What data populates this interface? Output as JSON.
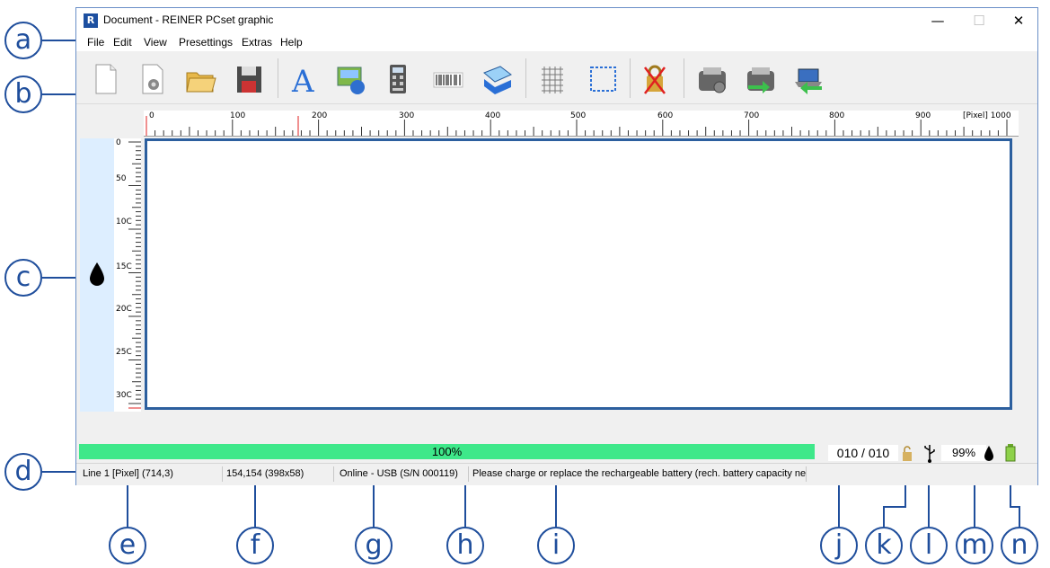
{
  "window": {
    "title": "Document - REINER PCset graphic",
    "app_icon_letter": "R",
    "minimize": "—",
    "maximize": "☐",
    "close": "✕"
  },
  "menu": [
    "File",
    "Edit",
    "View",
    "Presettings",
    "Extras",
    "Help"
  ],
  "toolbar": {
    "icons": [
      "new-document-icon",
      "new-from-template-icon",
      "open-folder-icon",
      "save-disk-icon",
      "text-icon",
      "image-icon",
      "calculator-icon",
      "barcode-icon",
      "layers-icon",
      "grid-icon",
      "selection-frame-icon",
      "lock-crossed-icon",
      "printer-settings-icon",
      "send-to-printer-icon",
      "receive-from-printer-icon"
    ]
  },
  "ruler": {
    "horizontal_labels": [
      "0",
      "100",
      "200",
      "300",
      "400",
      "500",
      "600",
      "700",
      "800",
      "900",
      "[Pixel] 1000"
    ],
    "vertical_labels": [
      "0",
      "50",
      "10C",
      "15C",
      "20C",
      "25C",
      "30C"
    ]
  },
  "progress": {
    "label": "100%",
    "value": 1.0,
    "color": "#3ee88a"
  },
  "counter": "010 / 010",
  "ink_level": "99%",
  "status": {
    "line": "Line 1 [Pixel] (714,3)",
    "coords": "154,154 (398x58)",
    "connection": "Online - USB (S/N 000119)",
    "message": "Please charge or replace the rechargeable battery (rech. battery capacity nea"
  },
  "callouts": [
    "a",
    "b",
    "c",
    "d",
    "e",
    "f",
    "g",
    "h",
    "i",
    "j",
    "k",
    "l",
    "m",
    "n"
  ],
  "colors": {
    "accent": "#1f4e9c",
    "progress": "#3ee88a",
    "canvas_border": "#2c5f9e"
  }
}
